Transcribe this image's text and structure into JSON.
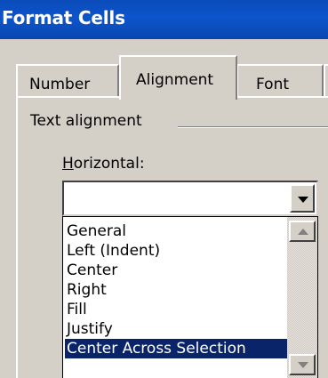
{
  "window": {
    "title": "Format Cells"
  },
  "tabs": [
    {
      "label": "Number",
      "active": false
    },
    {
      "label": "Alignment",
      "active": true
    },
    {
      "label": "Font",
      "active": false
    }
  ],
  "group": {
    "label": "Text alignment"
  },
  "horizontal": {
    "label_accel": "H",
    "label_rest": "orizontal:",
    "value": "",
    "options": [
      "General",
      "Left (Indent)",
      "Center",
      "Right",
      "Fill",
      "Justify",
      "Center Across Selection"
    ],
    "selected_index": 6
  },
  "colors": {
    "title_bar": "#0c55cc",
    "selection": "#0a246a",
    "dialog_bg": "#d4d0c8"
  }
}
